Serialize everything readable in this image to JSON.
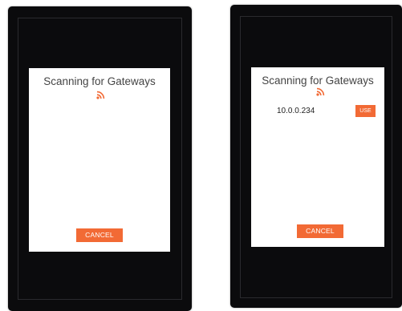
{
  "colors": {
    "accent": "#f26a35",
    "device_background": "#0b0b0d",
    "dialog_background": "#ffffff"
  },
  "left_screen": {
    "dialog": {
      "title": "Scanning for Gateways",
      "status_icon": "rss-icon",
      "cancel_label": "CANCEL"
    }
  },
  "right_screen": {
    "dialog": {
      "title": "Scanning for Gateways",
      "status_icon": "rss-icon",
      "gateways": [
        {
          "ip": "10.0.0.234",
          "action_label": "USE"
        }
      ],
      "cancel_label": "CANCEL"
    }
  }
}
